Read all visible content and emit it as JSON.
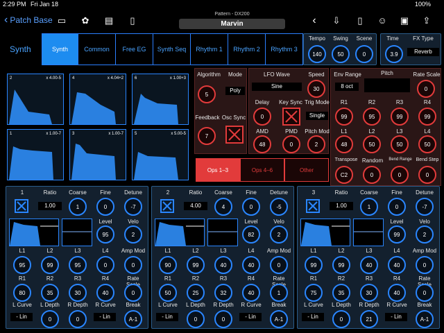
{
  "status": {
    "time": "2:29 PM",
    "date": "Fri Jan 18",
    "battery": "100%"
  },
  "header": {
    "back_label": "Patch Base",
    "pattern_title": "Pattern - DX200",
    "patch_name": "Marvin"
  },
  "synth_label": "Synth",
  "tabs": [
    "Synth",
    "Common",
    "Free EG",
    "Synth Seq",
    "Rhythm 1",
    "Rhythm 2",
    "Rhythm 3"
  ],
  "tempo": {
    "tempo_label": "Tempo",
    "tempo": "140",
    "swing_label": "Swing",
    "swing": "50",
    "scene_label": "Scene",
    "scene": "0"
  },
  "fx": {
    "time_label": "Time",
    "time": "3.9",
    "type_label": "FX Type",
    "type": "Reverb"
  },
  "ops_display": [
    {
      "num": "2",
      "ratio": "x 4.00-5"
    },
    {
      "num": "4",
      "ratio": "x 4.04+2"
    },
    {
      "num": "6",
      "ratio": "x 1.00+3"
    },
    {
      "num": "1",
      "ratio": "x 1.00-7"
    },
    {
      "num": "3",
      "ratio": "x 1.00-7"
    },
    {
      "num": "5",
      "ratio": "x 5.00-5"
    }
  ],
  "algo": {
    "algorithm_label": "Algorithm",
    "algorithm": "5",
    "mode_label": "Mode",
    "mode": "Poly",
    "feedback_label": "Feedback",
    "feedback": "7",
    "osc_sync_label": "Osc Sync"
  },
  "lfo": {
    "wave_label": "LFO Wave",
    "wave": "Sine",
    "speed_label": "Speed",
    "speed": "30",
    "delay_label": "Delay",
    "delay": "0",
    "key_sync_label": "Key Sync",
    "trig_mode_label": "Trig Mode",
    "trig_mode": "Single",
    "amd_label": "AMD",
    "amd": "48",
    "pmd_label": "PMD",
    "pmd": "0",
    "pitch_mod_label": "Pitch Mod",
    "pitch_mod": "2"
  },
  "pitch": {
    "env_range_label": "Env Range",
    "env_range": "8 oct",
    "pitch_label": "Pitch",
    "rate_scale_label": "Rate Scale",
    "rate_scale": "0",
    "r1_label": "R1",
    "r1": "99",
    "r2_label": "R2",
    "r2": "95",
    "r3_label": "R3",
    "r3": "99",
    "r4_label": "R4",
    "r4": "99",
    "l1_label": "L1",
    "l1": "48",
    "l2_label": "L2",
    "l2": "50",
    "l3_label": "L3",
    "l3": "50",
    "l4_label": "L4",
    "l4": "50",
    "transpose_label": "Transpose",
    "transpose": "C2",
    "random_label": "Random",
    "random": "0",
    "bend_range_label": "Bend Range",
    "bend_range": "0",
    "bend_step_label": "Bend Step",
    "bend_step": "0"
  },
  "op_tabs": [
    "Ops 1–3",
    "Ops 4–6",
    "Other"
  ],
  "op_labels": {
    "ratio": "Ratio",
    "coarse": "Coarse",
    "fine": "Fine",
    "detune": "Detune",
    "level": "Level",
    "velo": "Velo",
    "l1": "L1",
    "l2": "L2",
    "l3": "L3",
    "l4": "L4",
    "amp_mod": "Amp Mod",
    "r1": "R1",
    "r2": "R2",
    "r3": "R3",
    "r4": "R4",
    "rate_scale": "Rate Scale",
    "l_curve": "L Curve",
    "l_depth": "L Depth",
    "r_depth": "R Depth",
    "r_curve": "R Curve",
    "break": "Break"
  },
  "ops": [
    {
      "num": "1",
      "ratio": "1.00",
      "coarse": "1",
      "fine": "0",
      "detune": "-7",
      "level": "95",
      "velo": "2",
      "l1": "95",
      "l2": "99",
      "l3": "95",
      "l4": "0",
      "amp_mod": "0",
      "r1": "80",
      "r2": "35",
      "r3": "30",
      "r4": "40",
      "rate_scale": "0",
      "l_curve": "- Lin",
      "l_depth": "0",
      "r_depth": "0",
      "r_curve": "- Lin",
      "break": "A-1"
    },
    {
      "num": "2",
      "ratio": "4.00",
      "coarse": "4",
      "fine": "0",
      "detune": "-5",
      "level": "82",
      "velo": "2",
      "l1": "90",
      "l2": "99",
      "l3": "40",
      "l4": "40",
      "amp_mod": "0",
      "r1": "50",
      "r2": "25",
      "r3": "32",
      "r4": "40",
      "rate_scale": "1",
      "l_curve": "- Lin",
      "l_depth": "0",
      "r_depth": "0",
      "r_curve": "- Lin",
      "break": "A-1"
    },
    {
      "num": "3",
      "ratio": "1.00",
      "coarse": "1",
      "fine": "0",
      "detune": "-7",
      "level": "99",
      "velo": "2",
      "l1": "99",
      "l2": "99",
      "l3": "40",
      "l4": "40",
      "amp_mod": "0",
      "r1": "75",
      "r2": "35",
      "r3": "30",
      "r4": "40",
      "rate_scale": "0",
      "l_curve": "- Lin",
      "l_depth": "0",
      "r_depth": "21",
      "r_curve": "- Lin",
      "break": "A-1"
    }
  ],
  "icons": [
    "folder-icon",
    "palette-icon",
    "piano-icon",
    "phone-icon",
    "chevron-left-icon",
    "import-icon",
    "document-icon",
    "theater-icon",
    "archive-icon",
    "share-icon"
  ]
}
